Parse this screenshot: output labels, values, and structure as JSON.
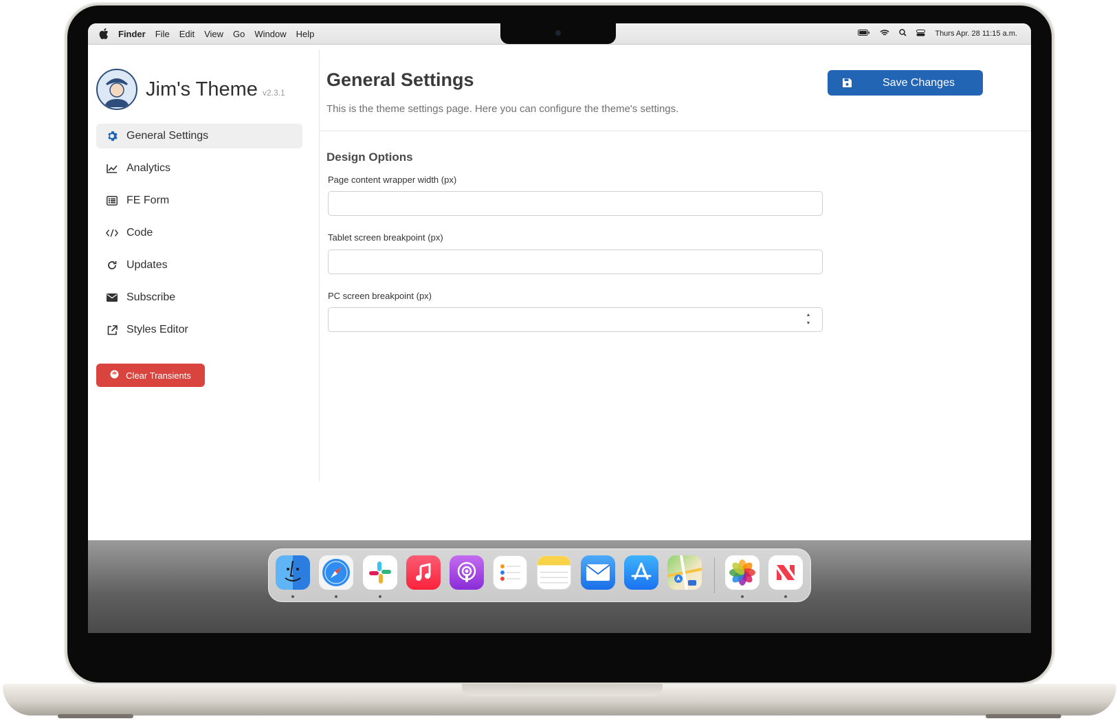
{
  "menubar": {
    "app_name": "Finder",
    "menus": [
      "File",
      "Edit",
      "View",
      "Go",
      "Window",
      "Help"
    ],
    "clock": "Thurs Apr. 28 11:15 a.m.",
    "status_icons": [
      "battery-icon",
      "wifi-icon",
      "search-icon",
      "control-center-icon"
    ]
  },
  "sidebar": {
    "brand_title": "Jim's Theme",
    "brand_version": "v2.3.1",
    "items": [
      {
        "label": "General Settings",
        "icon": "gear-icon",
        "active": true
      },
      {
        "label": "Analytics",
        "icon": "line-chart-icon",
        "active": false
      },
      {
        "label": "FE Form",
        "icon": "list-icon",
        "active": false
      },
      {
        "label": "Code",
        "icon": "code-icon",
        "active": false
      },
      {
        "label": "Updates",
        "icon": "refresh-icon",
        "active": false
      },
      {
        "label": "Subscribe",
        "icon": "envelope-icon",
        "active": false
      },
      {
        "label": "Styles Editor",
        "icon": "external-link-icon",
        "active": false
      }
    ],
    "clear_button": "Clear Transients"
  },
  "main": {
    "title": "General Settings",
    "description": "This is the theme settings page. Here you can configure the theme's settings.",
    "save_button": "Save Changes",
    "section_title": "Design Options",
    "fields": [
      {
        "label": "Page content wrapper width (px)",
        "value": ""
      },
      {
        "label": "Tablet screen breakpoint (px)",
        "value": ""
      },
      {
        "label": "PC screen breakpoint (px)",
        "value": ""
      }
    ]
  },
  "dock": {
    "apps": [
      "finder-icon",
      "safari-icon",
      "slack-icon",
      "music-icon",
      "podcasts-icon",
      "reminders-icon",
      "notes-icon",
      "mail-icon",
      "app-store-icon",
      "maps-icon",
      "photos-icon",
      "news-icon"
    ]
  },
  "colors": {
    "primary": "#2265b5",
    "danger": "#d9443e",
    "active_bg": "#efefef",
    "text": "#2f2f2f"
  }
}
